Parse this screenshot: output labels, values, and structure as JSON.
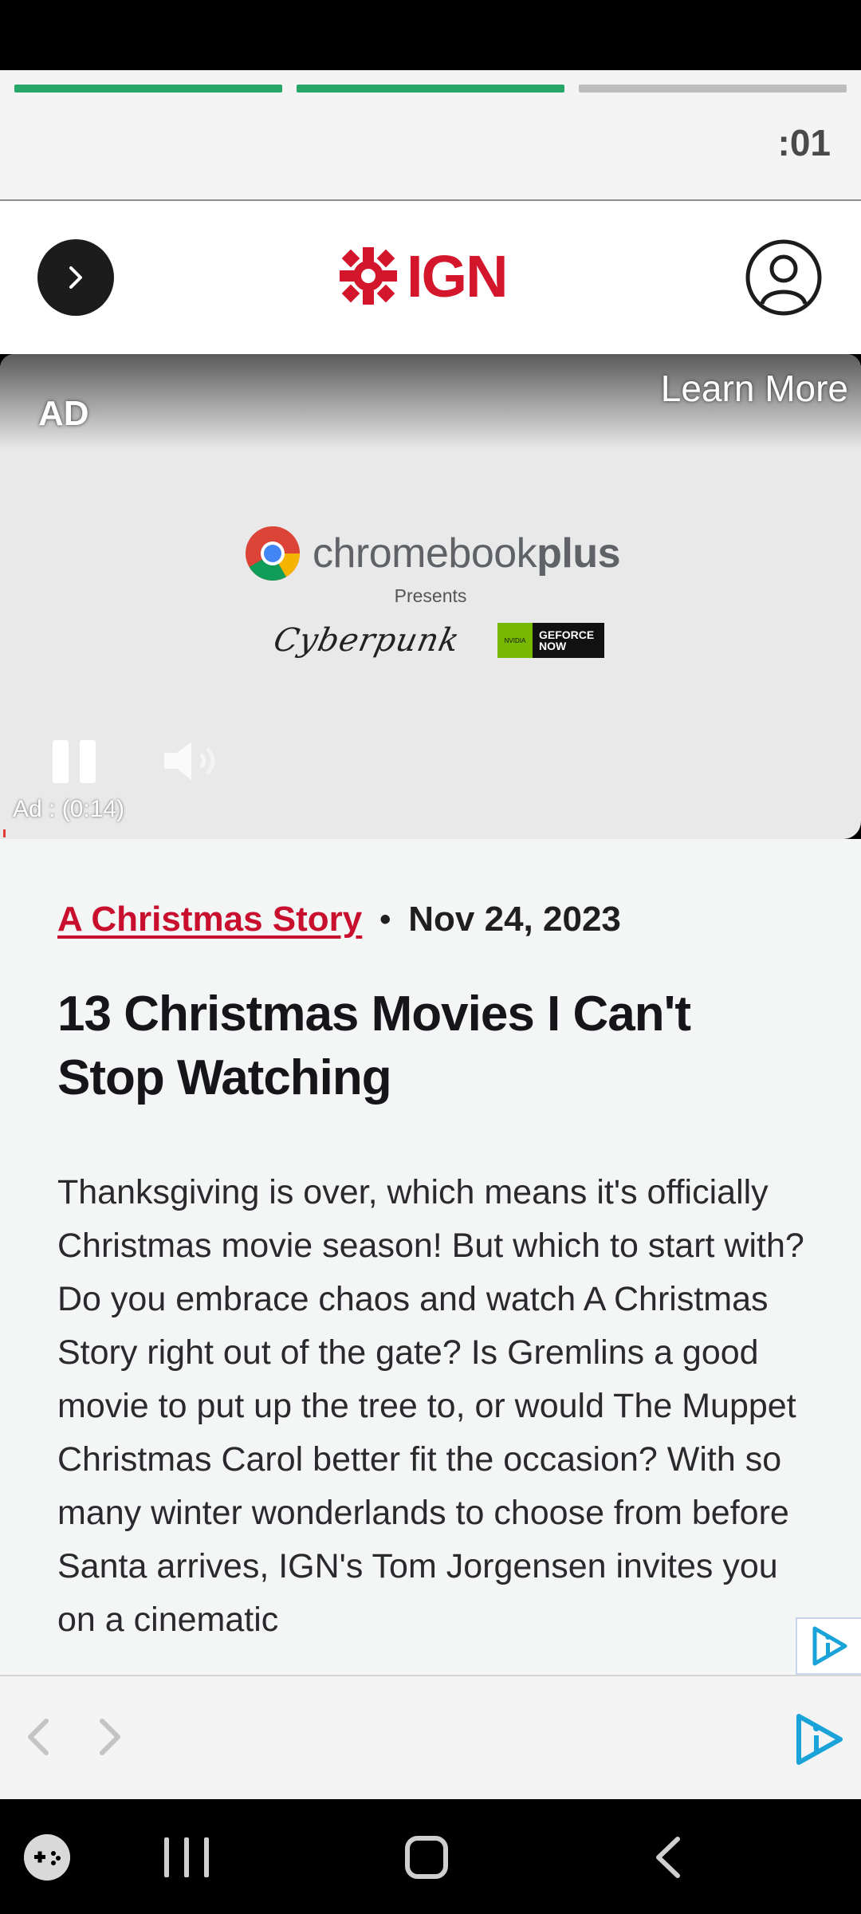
{
  "story": {
    "timer": ":01",
    "progress": [
      1.0,
      1.0,
      0.0
    ],
    "accent_color": "#27a66a"
  },
  "header": {
    "logo_text": "IGN",
    "brand_color": "#d3162b"
  },
  "ad": {
    "label": "AD",
    "learn_more": "Learn More",
    "brand_regular": "chromebook",
    "brand_bold": "plus",
    "presents": "Presents",
    "partner_1": "Cyberpunk",
    "partner_2_line1": "GEFORCE",
    "partner_2_line2": "NOW",
    "partner_2_badge": "NVIDIA",
    "time": "Ad : (0:14)"
  },
  "article": {
    "tag": "A Christmas Story",
    "separator": "•",
    "date": "Nov 24, 2023",
    "title": "13 Christmas Movies I Can't Stop Watching",
    "body": "Thanksgiving is over, which means it's officially Christmas movie season! But which to start with? Do you embrace chaos and watch A Christmas Story right out of the gate? Is Gremlins a good movie to put up the tree to, or would The Muppet Christmas Carol better fit the occasion? With so many winter wonderlands to choose from before Santa arrives, IGN's Tom Jorgensen invites you on a cinematic"
  }
}
